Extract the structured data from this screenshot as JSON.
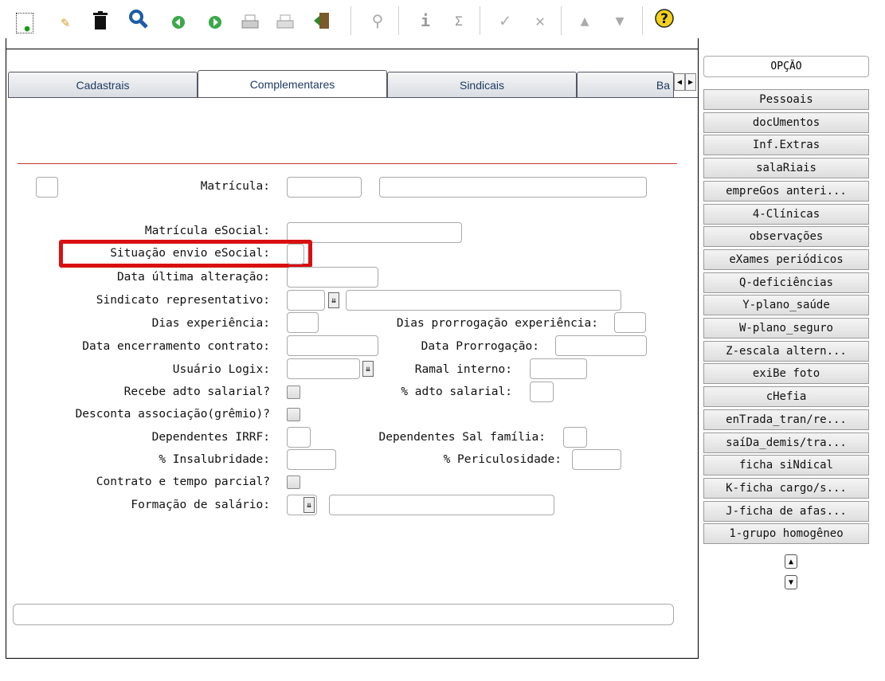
{
  "tabs": [
    "Cadastrais",
    "Complementares",
    "Sindicais",
    "Ba"
  ],
  "option_header": "OPÇÃO",
  "options": [
    "Pessoais",
    "docUmentos",
    "Inf.Extras",
    "salaRiais",
    "empreGos anteri...",
    "4-Clínicas",
    "observações",
    "eXames periódicos",
    "Q-deficiências",
    "Y-plano_saúde",
    "W-plano_seguro",
    "Z-escala altern...",
    "exiBe foto",
    "cHefia",
    "enTrada_tran/re...",
    "saíDa_demis/tra...",
    "ficha siNdical",
    "K-ficha cargo/s...",
    "J-ficha de afas...",
    "1-grupo homogêneo"
  ],
  "form": {
    "matricula": "Matrícula:",
    "matricula_esocial": "Matrícula eSocial:",
    "situacao_envio": "Situação envio eSocial:",
    "data_ultima": "Data última alteração:",
    "sindicato": "Sindicato representativo:",
    "dias_exp": "Dias experiência:",
    "dias_prorrog": "Dias prorrogação experiência:",
    "data_encerr": "Data encerramento contrato:",
    "data_prorrog": "Data Prorrogação:",
    "usuario_logix": "Usuário Logix:",
    "ramal": "Ramal interno:",
    "recebe_adto": "Recebe adto salarial?",
    "pct_adto": "% adto salarial:",
    "desconta": "Desconta associação(grêmio)?",
    "dep_irrf": "Dependentes IRRF:",
    "dep_sal": "Dependentes Sal família:",
    "insalub": "% Insalubridade:",
    "periculo": "% Periculosidade:",
    "contrato_parcial": "Contrato e tempo parcial?",
    "formacao": "Formação de salário:"
  },
  "toolbar_icons": [
    "new-icon",
    "edit-icon",
    "delete-icon",
    "search-icon",
    "previous-icon",
    "next-icon",
    "print-icon",
    "print-preview-icon",
    "exit-icon",
    "find-icon",
    "info-icon",
    "sum-icon",
    "sum2-icon",
    "confirm-icon",
    "cancel-icon",
    "up-icon",
    "down-icon",
    "help-icon"
  ]
}
